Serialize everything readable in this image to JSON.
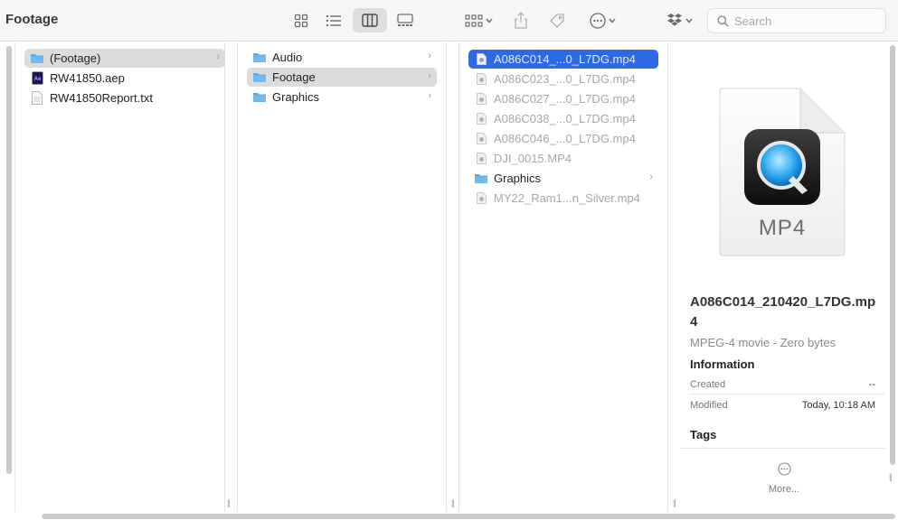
{
  "window": {
    "title": "Footage"
  },
  "toolbar": {
    "view_icon_label": "icon-view",
    "view_list_label": "list-view",
    "view_columns_label": "column-view",
    "view_gallery_label": "gallery-view",
    "search_placeholder": "Search"
  },
  "columns": {
    "col1": [
      {
        "label": "(Footage)",
        "kind": "folder",
        "selected": true
      },
      {
        "label": "RW41850.aep",
        "kind": "ae"
      },
      {
        "label": "RW41850Report.txt",
        "kind": "txt"
      }
    ],
    "col2": [
      {
        "label": "Audio",
        "kind": "folder"
      },
      {
        "label": "Footage",
        "kind": "folder",
        "selected": true
      },
      {
        "label": "Graphics",
        "kind": "folder"
      }
    ],
    "col3": [
      {
        "label": "A086C014_...0_L7DG.mp4",
        "kind": "video",
        "selected": true
      },
      {
        "label": "A086C023_...0_L7DG.mp4",
        "kind": "video"
      },
      {
        "label": "A086C027_...0_L7DG.mp4",
        "kind": "video"
      },
      {
        "label": "A086C038_...0_L7DG.mp4",
        "kind": "video"
      },
      {
        "label": "A086C046_...0_L7DG.mp4",
        "kind": "video"
      },
      {
        "label": "DJI_0015.MP4",
        "kind": "video"
      },
      {
        "label": "Graphics",
        "kind": "folder"
      },
      {
        "label": "MY22_Ram1...n_Silver.mp4",
        "kind": "video"
      }
    ]
  },
  "preview": {
    "thumb_label": "MP4",
    "name": "A086C014_210420_L7DG.mp4",
    "kind": "MPEG-4 movie - Zero bytes",
    "info_heading": "Information",
    "created_label": "Created",
    "created_value": "--",
    "modified_label": "Modified",
    "modified_value": "Today, 10:18 AM",
    "tags_heading": "Tags",
    "more_label": "More..."
  },
  "colors": {
    "selection_blue": "#2f6ae6",
    "selection_gray": "#dcdcdc",
    "folder_blue": "#5aa9e6"
  }
}
